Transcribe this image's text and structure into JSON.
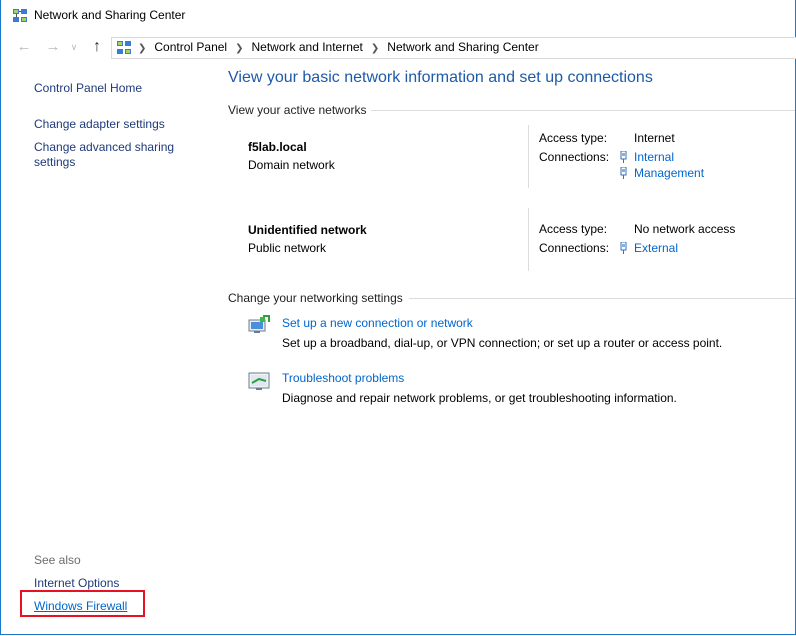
{
  "window": {
    "title": "Network and Sharing Center"
  },
  "nav": {
    "back_icon": "back-arrow-icon",
    "forward_icon": "forward-arrow-icon",
    "recent_icon": "chevron-down-icon",
    "up_icon": "up-arrow-icon",
    "breadcrumbs": [
      "Control Panel",
      "Network and Internet",
      "Network and Sharing Center"
    ]
  },
  "left_pane": {
    "home": "Control Panel Home",
    "links": [
      "Change adapter settings",
      "Change advanced sharing",
      "settings"
    ],
    "see_also": "See also",
    "see_also_links": [
      "Internet Options",
      "Windows Firewall"
    ]
  },
  "main": {
    "title": "View your basic network information and set up connections",
    "active_networks_header": "View your active networks",
    "networks": [
      {
        "name": "f5lab.local",
        "type": "Domain network",
        "access_label": "Access type:",
        "access_value": "Internet",
        "connections_label": "Connections:",
        "connections": [
          "Internal",
          "Management"
        ]
      },
      {
        "name": "Unidentified network",
        "type": "Public network",
        "access_label": "Access type:",
        "access_value": "No network access",
        "connections_label": "Connections:",
        "connections": [
          "External"
        ]
      }
    ],
    "change_header": "Change your networking settings",
    "tasks": [
      {
        "icon": "new-connection-icon",
        "link": "Set up a new connection or network",
        "desc": "Set up a broadband, dial-up, or VPN connection; or set up a router or access point."
      },
      {
        "icon": "troubleshoot-icon",
        "link": "Troubleshoot problems",
        "desc": "Diagnose and repair network problems, or get troubleshooting information."
      }
    ]
  },
  "colors": {
    "link": "#0066cc",
    "title": "#1e5aa8",
    "highlight_box": "#e81123",
    "window_border": "#1979ca"
  }
}
